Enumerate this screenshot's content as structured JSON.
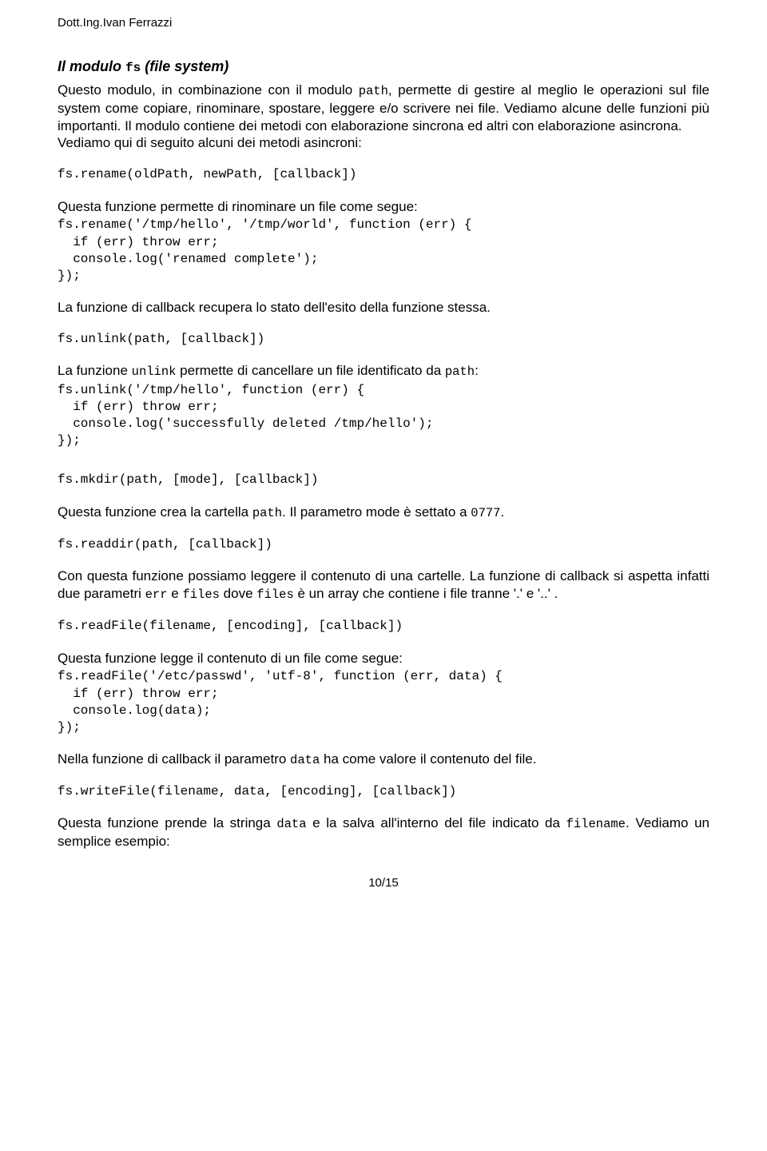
{
  "header": {
    "author": "Dott.Ing.Ivan Ferrazzi"
  },
  "title": {
    "pre": "Il modulo ",
    "mono": "fs",
    "post": " (file system)"
  },
  "intro": {
    "p1_pre": "Questo modulo, in combinazione con il modulo ",
    "p1_path": "path",
    "p1_post": ", permette di gestire al meglio le operazioni sul file system come copiare, rinominare, spostare, leggere e/o scrivere nei file. Vediamo alcune delle funzioni più importanti. Il modulo contiene dei metodi con elaborazione sincrona ed altri con elaborazione asincrona.",
    "p2": "Vediamo qui di seguito alcuni dei metodi asincroni:"
  },
  "rename": {
    "sig": "fs.rename(oldPath, newPath, [callback])",
    "desc": "Questa funzione permette di rinominare un file come segue:",
    "code": "fs.rename('/tmp/hello', '/tmp/world', function (err) {\n  if (err) throw err;\n  console.log('renamed complete');\n});",
    "after": "La funzione di callback recupera lo stato dell'esito della funzione stessa."
  },
  "unlink": {
    "sig": "fs.unlink(path, [callback])",
    "desc_pre": "La funzione ",
    "desc_mono1": "unlink",
    "desc_mid": " permette di cancellare un file identificato da ",
    "desc_mono2": "path",
    "desc_post": ":",
    "code": "fs.unlink('/tmp/hello', function (err) {\n  if (err) throw err;\n  console.log('successfully deleted /tmp/hello');\n});"
  },
  "mkdir": {
    "sig": "fs.mkdir(path, [mode], [callback])",
    "desc_pre": "Questa funzione crea la cartella ",
    "desc_mono1": "path",
    "desc_mid": ". Il parametro mode è settato a ",
    "desc_mono2": "0777",
    "desc_post": "."
  },
  "readdir": {
    "sig": "fs.readdir(path, [callback])",
    "desc_pre": "Con questa funzione possiamo leggere il contenuto di una cartelle. La funzione di callback si aspetta infatti due parametri ",
    "desc_mono1": "err",
    "desc_mid1": " e ",
    "desc_mono2": "files",
    "desc_mid2": " dove ",
    "desc_mono3": "files",
    "desc_post": " è un array che contiene i file tranne '.' e '..' ."
  },
  "readfile": {
    "sig": "fs.readFile(filename, [encoding], [callback])",
    "desc": "Questa funzione legge il contenuto di un file come segue:",
    "code": "fs.readFile('/etc/passwd', 'utf-8', function (err, data) {\n  if (err) throw err;\n  console.log(data);\n});",
    "after_pre": "Nella funzione di callback il parametro ",
    "after_mono": "data",
    "after_post": " ha come valore il contenuto del file."
  },
  "writefile": {
    "sig": "fs.writeFile(filename, data, [encoding], [callback])",
    "desc_pre": "Questa funzione prende la stringa ",
    "desc_mono1": "data",
    "desc_mid": " e la salva all'interno del file indicato da ",
    "desc_mono2": "filename",
    "desc_post": ". Vediamo un semplice esempio:"
  },
  "footer": {
    "page": "10/15"
  }
}
